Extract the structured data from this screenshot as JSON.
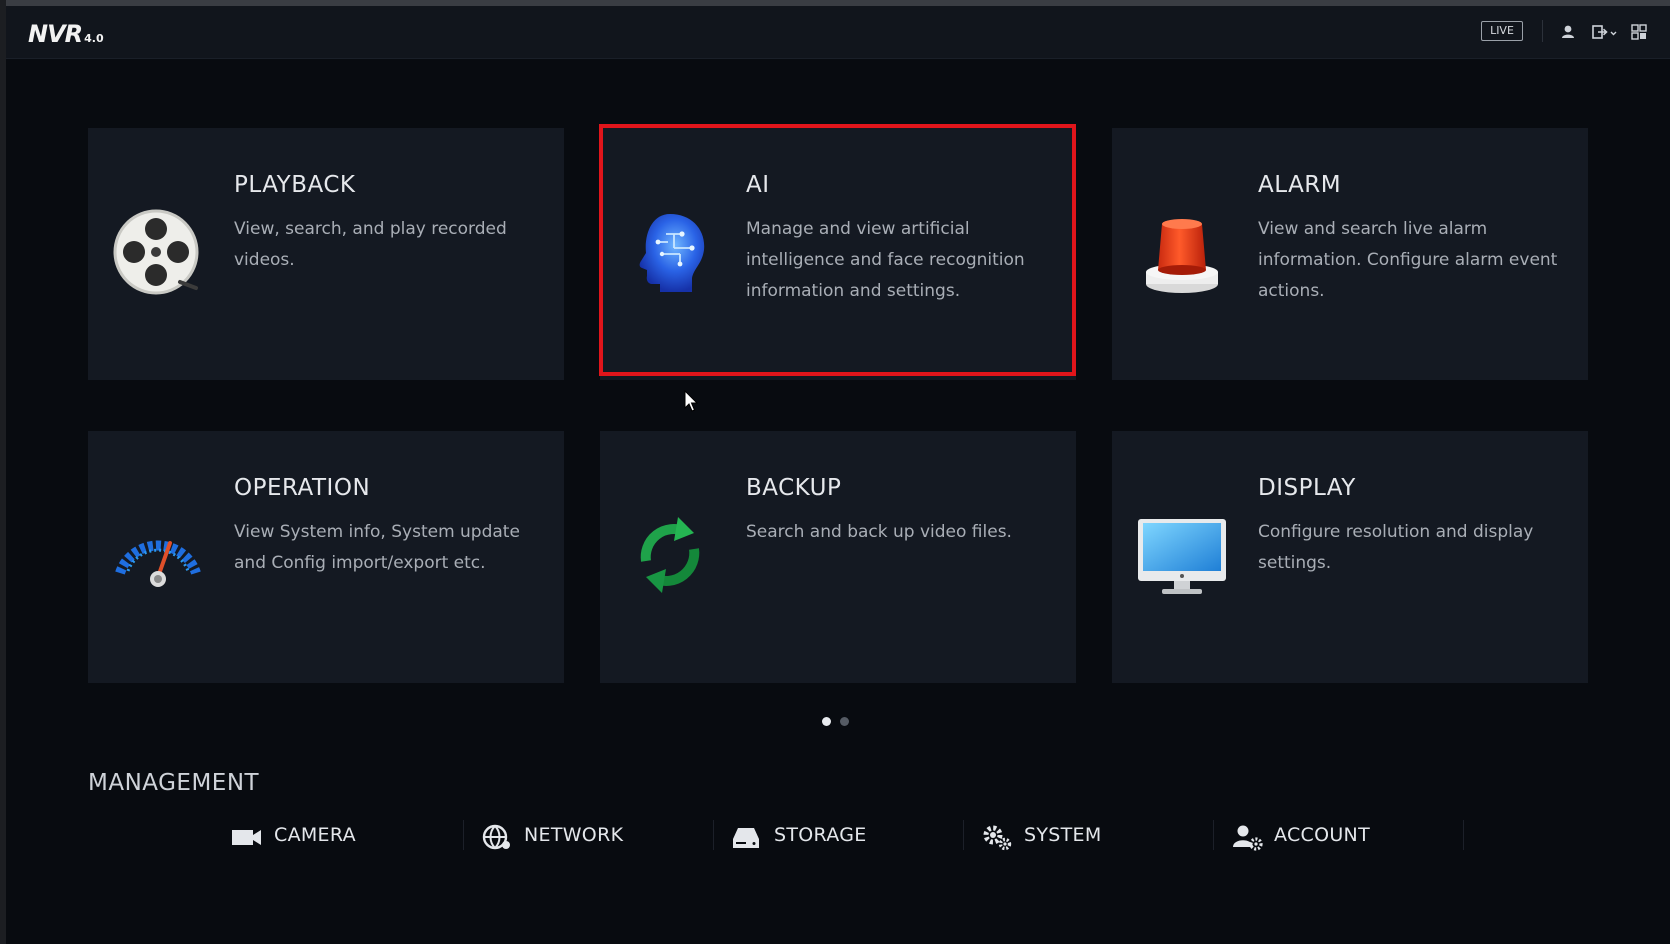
{
  "header": {
    "logo_text": "NVR",
    "logo_version": "4.0",
    "live_label": "LIVE",
    "icons": [
      "user-icon",
      "logout-icon",
      "grid-icon"
    ]
  },
  "cards": [
    {
      "title": "PLAYBACK",
      "description": "View, search, and play recorded videos.",
      "icon": "film-reel-icon"
    },
    {
      "title": "AI",
      "description": "Manage and view artificial intelligence and face recognition information and settings.",
      "icon": "ai-head-icon"
    },
    {
      "title": "ALARM",
      "description": "View and search live alarm information. Configure alarm event actions.",
      "icon": "alarm-siren-icon"
    },
    {
      "title": "OPERATION",
      "description": "View System info, System update and Config import/export etc.",
      "icon": "gauge-icon"
    },
    {
      "title": "BACKUP",
      "description": "Search and back up video files.",
      "icon": "sync-arrows-icon"
    },
    {
      "title": "DISPLAY",
      "description": "Configure resolution and display settings.",
      "icon": "monitor-icon"
    }
  ],
  "pagination": {
    "current": 1,
    "total": 2
  },
  "management": {
    "title": "MANAGEMENT",
    "items": [
      {
        "label": "CAMERA",
        "icon": "camera-icon"
      },
      {
        "label": "NETWORK",
        "icon": "network-globe-icon"
      },
      {
        "label": "STORAGE",
        "icon": "storage-drive-icon"
      },
      {
        "label": "SYSTEM",
        "icon": "gears-icon"
      },
      {
        "label": "ACCOUNT",
        "icon": "account-gear-icon"
      }
    ]
  },
  "colors": {
    "highlight_border": "#e0151b",
    "background": "#080b10",
    "card": "#141922"
  }
}
